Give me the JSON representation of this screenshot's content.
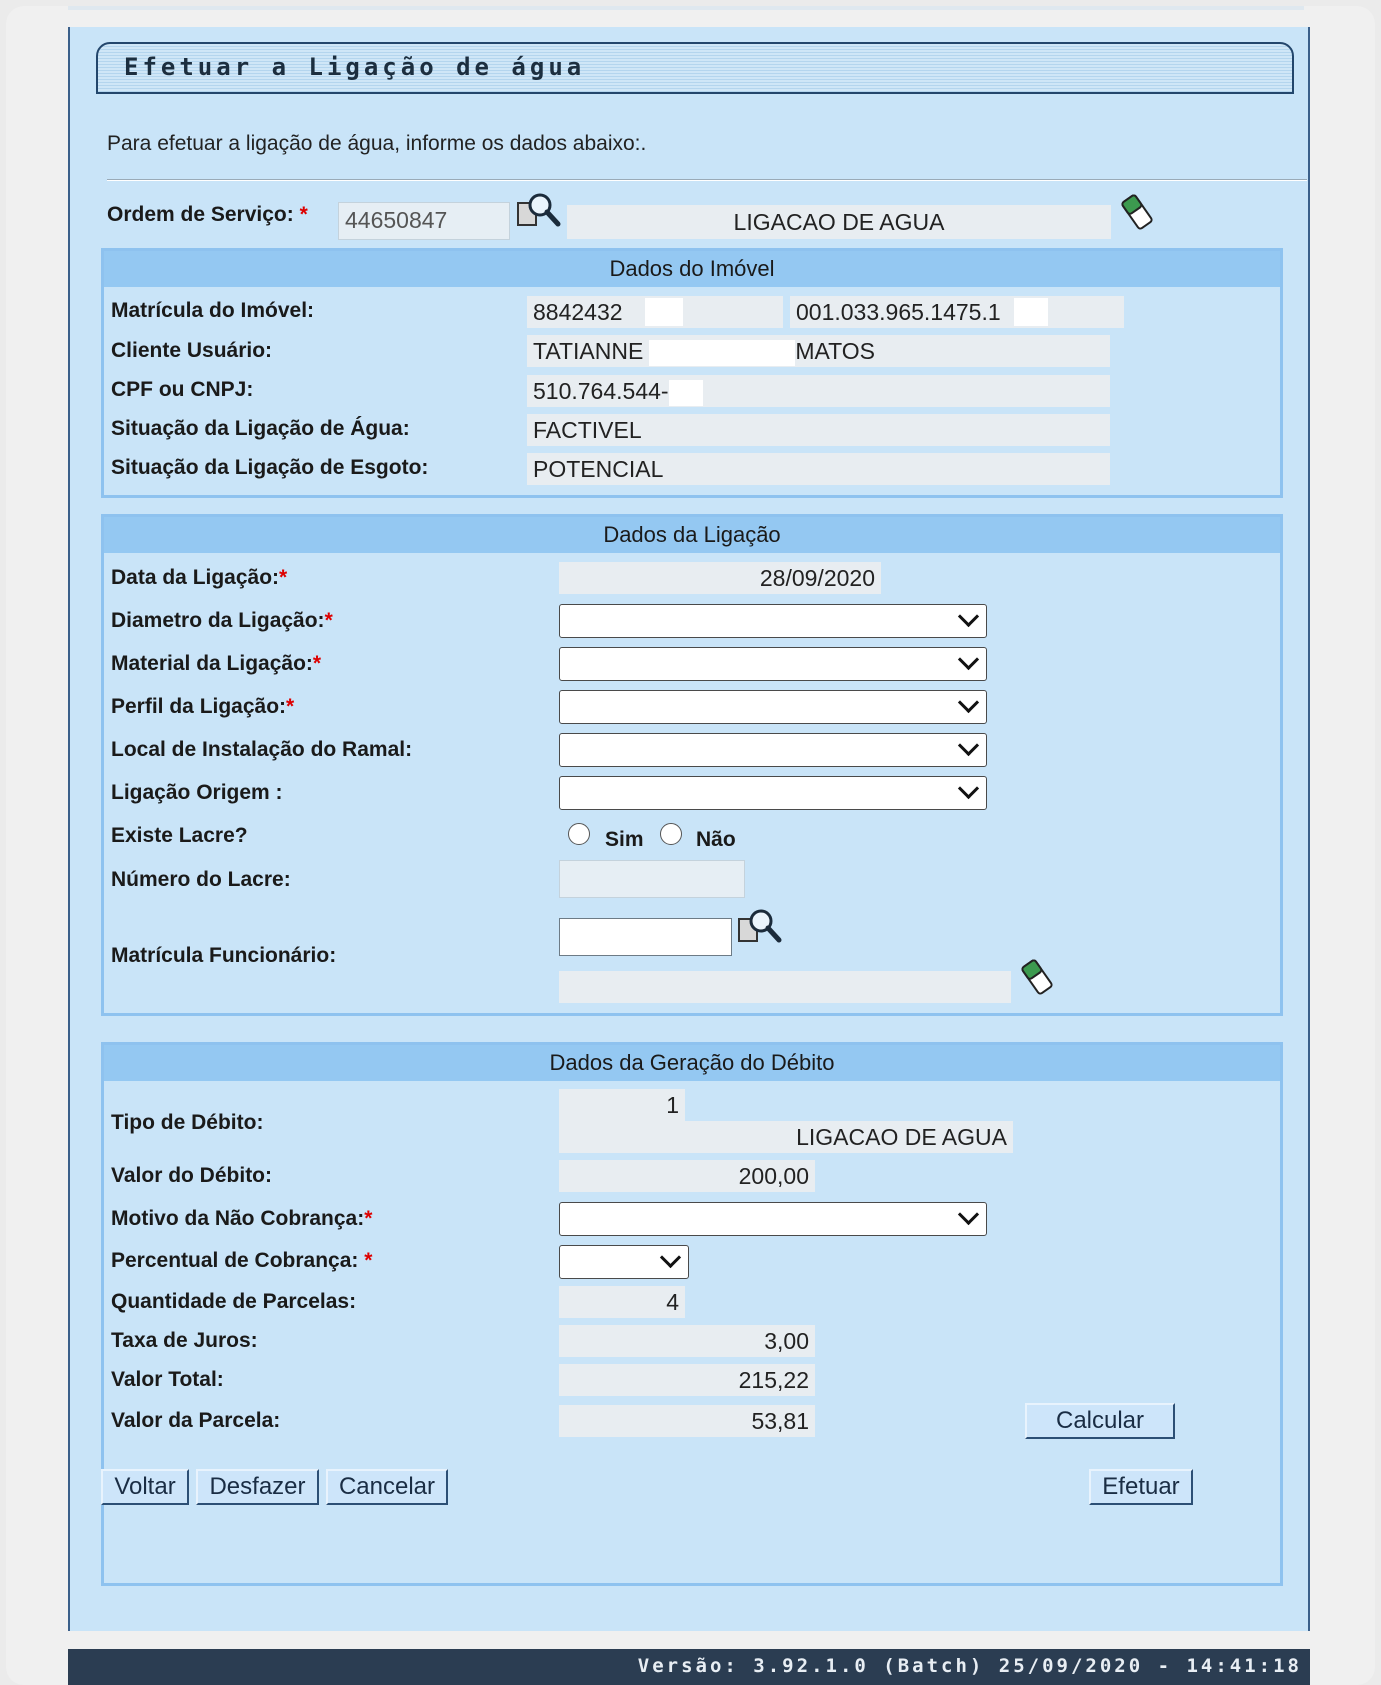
{
  "window": {
    "title": "Efetuar a Ligação de água"
  },
  "intro": "Para efetuar a ligação de água, informe os dados abaixo:.",
  "ordem": {
    "label": "Ordem de Serviço:",
    "required": "*",
    "value": "44650847",
    "description": "LIGACAO DE AGUA"
  },
  "imovel": {
    "header": "Dados do Imóvel",
    "matricula_label": "Matrícula do Imóvel:",
    "matricula_value": "8842432",
    "inscricao_value": "001.033.965.1475.1",
    "cliente_label": "Cliente Usuário:",
    "cliente_first": "TATIANNE",
    "cliente_last": "MATOS",
    "cpf_label": "CPF ou CNPJ:",
    "cpf_value": "510.764.544-",
    "sit_agua_label": "Situação da Ligação de Água:",
    "sit_agua_value": "FACTIVEL",
    "sit_esgoto_label": "Situação da Ligação de Esgoto:",
    "sit_esgoto_value": "POTENCIAL"
  },
  "ligacao": {
    "header": "Dados da Ligação",
    "data_label": "Data da Ligação:",
    "data_value": "28/09/2020",
    "diametro_label": "Diametro da Ligação:",
    "material_label": "Material da Ligação:",
    "perfil_label": "Perfil da Ligação:",
    "local_label": "Local de Instalação do Ramal:",
    "origem_label": "Ligação Origem :",
    "lacre_label": "Existe Lacre?",
    "lacre_sim": "Sim",
    "lacre_nao": "Não",
    "numero_lacre_label": "Número do Lacre:",
    "funcionario_label": "Matrícula Funcionário:"
  },
  "debito": {
    "header": "Dados da Geração do Débito",
    "tipo_label": "Tipo de Débito:",
    "tipo_code": "1",
    "tipo_desc": "LIGACAO DE AGUA",
    "valor_label": "Valor do Débito:",
    "valor_value": "200,00",
    "motivo_label": "Motivo da Não Cobrança:",
    "percentual_label": "Percentual de Cobrança:",
    "parcelas_label": "Quantidade de Parcelas:",
    "parcelas_value": "4",
    "juros_label": "Taxa de Juros:",
    "juros_value": "3,00",
    "total_label": "Valor Total:",
    "total_value": "215,22",
    "parcela_label": "Valor da Parcela:",
    "parcela_value": "53,81",
    "calcular": "Calcular"
  },
  "buttons": {
    "voltar": "Voltar",
    "desfazer": "Desfazer",
    "cancelar": "Cancelar",
    "efetuar": "Efetuar"
  },
  "footer": "Versão: 3.92.1.0 (Batch) 25/09/2020 - 14:41:18",
  "required_mark": "*",
  "colors": {
    "page_bg": "#c9e4f8",
    "section_header": "#94c8f2",
    "required": "#dd0000",
    "footer_bg": "#2b3d52"
  },
  "icons": [
    "search-icon",
    "eraser-icon",
    "chevron-down-icon"
  ]
}
